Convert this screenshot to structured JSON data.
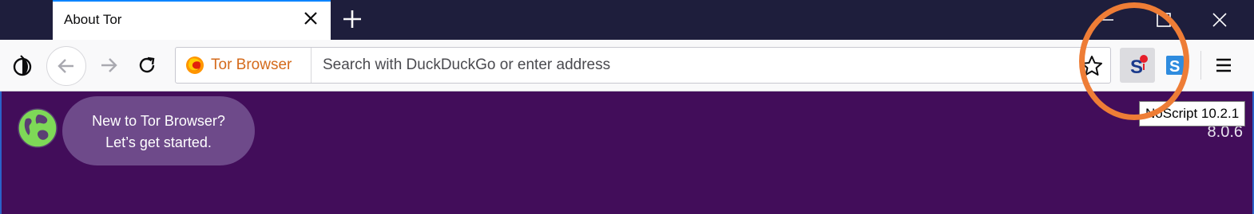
{
  "tab": {
    "title": "About Tor"
  },
  "urlbar": {
    "identity_label": "Tor Browser",
    "placeholder": "Search with DuckDuckGo or enter address"
  },
  "content": {
    "bubble_line1": "New to Tor Browser?",
    "bubble_line2": "Let’s get started.",
    "version": "8.0.6"
  },
  "tooltip": {
    "text": "NoScript 10.2.1"
  },
  "icons": {
    "onion": "tor-onion-icon",
    "back": "back-arrow-icon",
    "forward": "forward-arrow-icon",
    "reload": "reload-icon",
    "identity": "firefox-logo-icon",
    "star": "star-icon",
    "noscript": "noscript-icon",
    "ext2": "extension-s-icon",
    "menu": "hamburger-menu-icon",
    "globe": "globe-icon"
  },
  "colors": {
    "page_background": "#420d5a",
    "titlebar": "#1e1e3c",
    "identity_label": "#d46a1b",
    "highlight_ring": "#ee7d36",
    "bubble": "#6e4a8a"
  }
}
